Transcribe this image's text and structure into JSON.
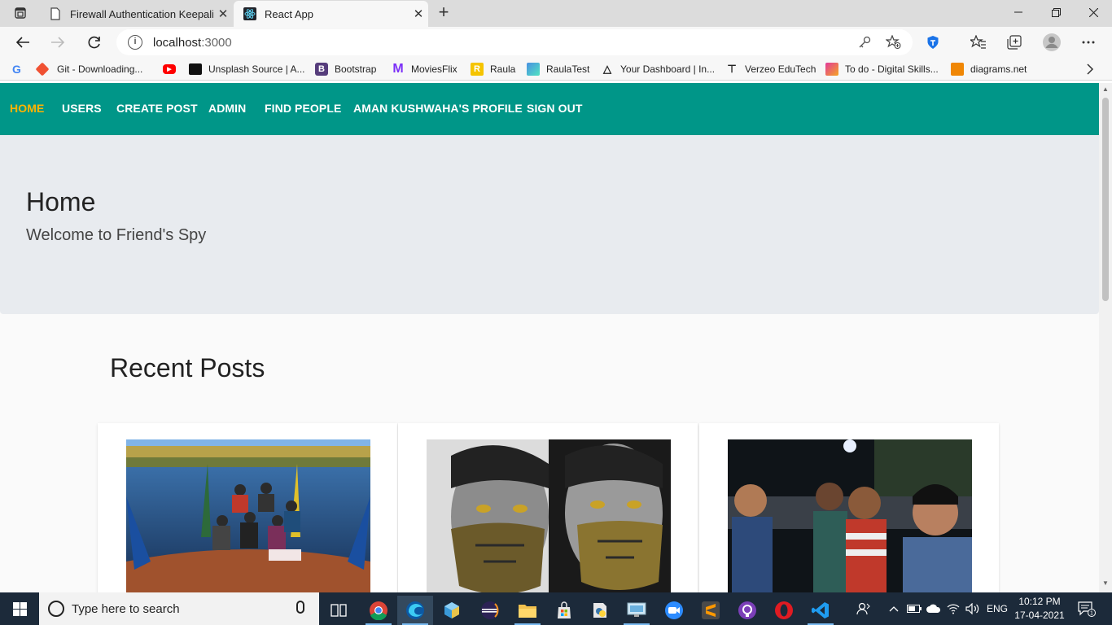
{
  "browser": {
    "tabs": [
      {
        "title": "Firewall Authentication Keepalive",
        "active": false
      },
      {
        "title": "React App",
        "active": true
      }
    ],
    "address": {
      "host": "localhost",
      "port": ":3000"
    },
    "bookmarks": [
      {
        "label": "",
        "icon": "google-icon",
        "color": "#4285f4"
      },
      {
        "label": "Git - Downloading...",
        "icon": "git-icon",
        "color": "#f05133"
      },
      {
        "label": "",
        "icon": "youtube-icon",
        "color": "#ff0000"
      },
      {
        "label": "Unsplash Source | A...",
        "icon": "unsplash-icon",
        "color": "#111111"
      },
      {
        "label": "Bootstrap",
        "icon": "bootstrap-icon",
        "color": "#563d7c"
      },
      {
        "label": "MoviesFlix",
        "icon": "moviesflix-icon",
        "color": "#7b2ff7"
      },
      {
        "label": "Raula",
        "icon": "raula-icon",
        "color": "#f5c400"
      },
      {
        "label": "RaulaTest",
        "icon": "raulatest-icon",
        "color": "#4a90e2"
      },
      {
        "label": "Your Dashboard | In...",
        "icon": "dashboard-icon",
        "color": "#222222"
      },
      {
        "label": "Verzeo EduTech",
        "icon": "verzeo-icon",
        "color": "#222222"
      },
      {
        "label": "To do - Digital Skills...",
        "icon": "todo-icon",
        "color": "#e2399b"
      },
      {
        "label": "diagrams.net",
        "icon": "diagrams-icon",
        "color": "#f08705"
      }
    ]
  },
  "app": {
    "nav": [
      {
        "label": "HOME",
        "active": true
      },
      {
        "label": "USERS",
        "active": false
      },
      {
        "label": "CREATE POST",
        "active": false
      },
      {
        "label": "ADMIN",
        "active": false
      },
      {
        "label": "FIND PEOPLE",
        "active": false
      },
      {
        "label": "AMAN KUSHWAHA'S PROFILE",
        "active": false
      },
      {
        "label": "SIGN OUT",
        "active": false
      }
    ],
    "hero": {
      "title": "Home",
      "subtitle": "Welcome to Friend's Spy"
    },
    "recent_title": "Recent Posts",
    "posts": [
      {
        "image": "group-on-boat-photo"
      },
      {
        "image": "two-masked-friends-photo"
      },
      {
        "image": "night-selfie-photo"
      }
    ]
  },
  "taskbar": {
    "search_placeholder": "Type here to search",
    "language": "ENG",
    "time": "10:12 PM",
    "date": "17-04-2021",
    "notifications": "1",
    "apps": [
      "task-view-icon",
      "chrome-icon",
      "edge-icon",
      "3d-viewer-icon",
      "eclipse-icon",
      "file-explorer-icon",
      "store-icon",
      "python-icon",
      "remote-desktop-icon",
      "zoom-icon",
      "sublime-icon",
      "github-icon",
      "opera-icon",
      "vscode-icon"
    ]
  }
}
